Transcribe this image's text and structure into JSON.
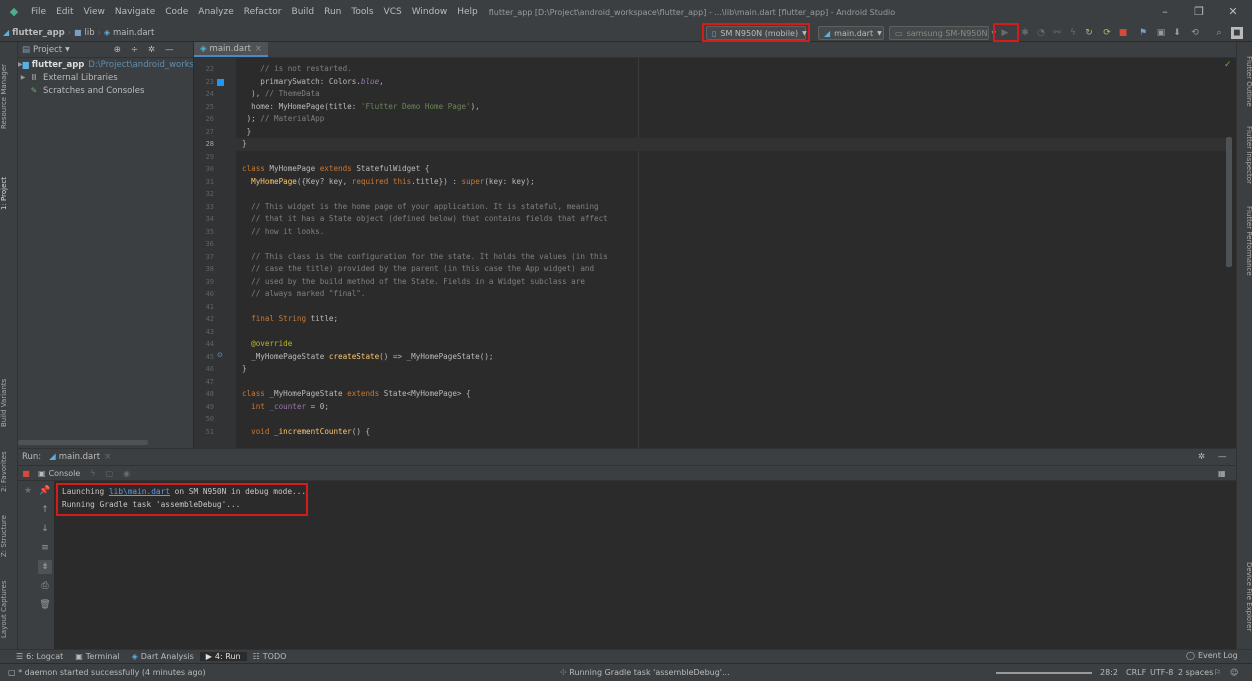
{
  "menubar": {
    "items": [
      "File",
      "Edit",
      "View",
      "Navigate",
      "Code",
      "Analyze",
      "Refactor",
      "Build",
      "Run",
      "Tools",
      "VCS",
      "Window",
      "Help"
    ],
    "window_title": "flutter_app [D:\\Project\\android_workspace\\flutter_app] - ...\\lib\\main.dart [flutter_app] - Android Studio",
    "minimize": "–",
    "maximize": "❐",
    "close": "✕"
  },
  "navbar": {
    "crumbs": [
      "flutter_app",
      "lib",
      "main.dart"
    ],
    "device_selector": "SM N950N (mobile)",
    "run_config": "main.dart",
    "target_device": "samsung SM-N950N"
  },
  "project_panel": {
    "title": "Project",
    "items": [
      {
        "name": "flutter_app",
        "path": "D:\\Project\\android_workspa"
      },
      {
        "name": "External Libraries"
      },
      {
        "name": "Scratches and Consoles"
      }
    ]
  },
  "editor": {
    "tab": "main.dart",
    "lines": [
      {
        "n": "22",
        "code": "    // is not restarted."
      },
      {
        "n": "23",
        "code": "    primarySwatch: Colors.blue,"
      },
      {
        "n": "24",
        "code": "  ), // ThemeData"
      },
      {
        "n": "25",
        "code": "  home: MyHomePage(title: 'Flutter Demo Home Page'),"
      },
      {
        "n": "26",
        "code": " ); // MaterialApp"
      },
      {
        "n": "27",
        "code": " }"
      },
      {
        "n": "28",
        "code": "}"
      },
      {
        "n": "29",
        "code": ""
      },
      {
        "n": "30",
        "code": "class MyHomePage extends StatefulWidget {"
      },
      {
        "n": "31",
        "code": "  MyHomePage({Key? key, required this.title}) : super(key: key);"
      },
      {
        "n": "32",
        "code": ""
      },
      {
        "n": "33",
        "code": "  // This widget is the home page of your application. It is stateful, meaning"
      },
      {
        "n": "34",
        "code": "  // that it has a State object (defined below) that contains fields that affect"
      },
      {
        "n": "35",
        "code": "  // how it looks."
      },
      {
        "n": "36",
        "code": ""
      },
      {
        "n": "37",
        "code": "  // This class is the configuration for the state. It holds the values (in this"
      },
      {
        "n": "38",
        "code": "  // case the title) provided by the parent (in this case the App widget) and"
      },
      {
        "n": "39",
        "code": "  // used by the build method of the State. Fields in a Widget subclass are"
      },
      {
        "n": "40",
        "code": "  // always marked \"final\"."
      },
      {
        "n": "41",
        "code": ""
      },
      {
        "n": "42",
        "code": "  final String title;"
      },
      {
        "n": "43",
        "code": ""
      },
      {
        "n": "44",
        "code": "  @override"
      },
      {
        "n": "45",
        "code": "  _MyHomePageState createState() => _MyHomePageState();"
      },
      {
        "n": "46",
        "code": "}"
      },
      {
        "n": "47",
        "code": ""
      },
      {
        "n": "48",
        "code": "class _MyHomePageState extends State<MyHomePage> {"
      },
      {
        "n": "49",
        "code": "  int _counter = 0;"
      },
      {
        "n": "50",
        "code": ""
      },
      {
        "n": "51",
        "code": "  void _incrementCounter() {"
      }
    ]
  },
  "run_panel": {
    "title": "Run:",
    "run_tab": "main.dart",
    "console_tab": "Console",
    "console_lines": [
      {
        "prefix": "Launching ",
        "link": "lib\\main.dart",
        "suffix": " on SM N950N in debug mode..."
      },
      {
        "prefix": "Running Gradle task 'assembleDebug'...",
        "link": "",
        "suffix": ""
      }
    ]
  },
  "left_stripe": [
    "Resource Manager",
    "1: Project",
    "Build Variants",
    "2: Favorites",
    "Z: Structure",
    "Layout Captures"
  ],
  "right_stripe": [
    "Flutter Outline",
    "Flutter Inspector",
    "Flutter Performance",
    "Device File Explorer"
  ],
  "bottom_tabs": [
    {
      "label": "6: Logcat"
    },
    {
      "label": "Terminal"
    },
    {
      "label": "Dart Analysis"
    },
    {
      "label": "4: Run"
    },
    {
      "label": "TODO"
    }
  ],
  "event_log": "Event Log",
  "status": {
    "left": "* daemon started successfully (4 minutes ago)",
    "center": "Running Gradle task 'assembleDebug'...",
    "position": "28:2",
    "line_sep": "CRLF",
    "encoding": "UTF-8",
    "indent": "2 spaces"
  }
}
